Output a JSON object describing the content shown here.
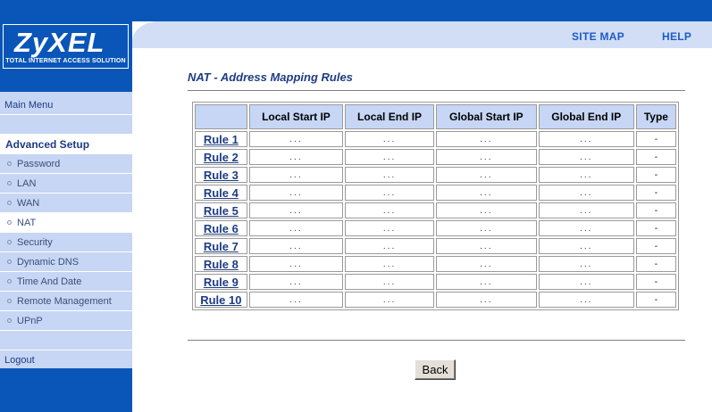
{
  "brand": {
    "name": "ZyXEL",
    "tagline": "Total Internet Access Solution"
  },
  "header": {
    "site_map": "SITE MAP",
    "help": "HELP"
  },
  "sidebar": {
    "main_menu": "Main Menu",
    "section": "Advanced Setup",
    "items": [
      {
        "label": "Password"
      },
      {
        "label": "LAN"
      },
      {
        "label": "WAN"
      },
      {
        "label": "NAT"
      },
      {
        "label": "Security"
      },
      {
        "label": "Dynamic DNS"
      },
      {
        "label": "Time And Date"
      },
      {
        "label": "Remote Management"
      },
      {
        "label": "UPnP"
      }
    ],
    "logout": "Logout"
  },
  "page": {
    "title": "NAT - Address Mapping Rules",
    "back_label": "Back"
  },
  "table": {
    "headers": [
      "",
      "Local Start IP",
      "Local End IP",
      "Global Start IP",
      "Global End IP",
      "Type"
    ],
    "rows": [
      {
        "rule": "Rule 1",
        "local_start": "...",
        "local_end": "...",
        "global_start": "...",
        "global_end": "...",
        "type": "-"
      },
      {
        "rule": "Rule 2",
        "local_start": "...",
        "local_end": "...",
        "global_start": "...",
        "global_end": "...",
        "type": "-"
      },
      {
        "rule": "Rule 3",
        "local_start": "...",
        "local_end": "...",
        "global_start": "...",
        "global_end": "...",
        "type": "-"
      },
      {
        "rule": "Rule 4",
        "local_start": "...",
        "local_end": "...",
        "global_start": "...",
        "global_end": "...",
        "type": "-"
      },
      {
        "rule": "Rule 5",
        "local_start": "...",
        "local_end": "...",
        "global_start": "...",
        "global_end": "...",
        "type": "-"
      },
      {
        "rule": "Rule 6",
        "local_start": "...",
        "local_end": "...",
        "global_start": "...",
        "global_end": "...",
        "type": "-"
      },
      {
        "rule": "Rule 7",
        "local_start": "...",
        "local_end": "...",
        "global_start": "...",
        "global_end": "...",
        "type": "-"
      },
      {
        "rule": "Rule 8",
        "local_start": "...",
        "local_end": "...",
        "global_start": "...",
        "global_end": "...",
        "type": "-"
      },
      {
        "rule": "Rule 9",
        "local_start": "...",
        "local_end": "...",
        "global_start": "...",
        "global_end": "...",
        "type": "-"
      },
      {
        "rule": "Rule 10",
        "local_start": "...",
        "local_end": "...",
        "global_start": "...",
        "global_end": "...",
        "type": "-"
      }
    ]
  },
  "colors": {
    "brand_blue": "#0a56b8",
    "menu_bg": "#c6d6f4",
    "header_light": "#d2def6",
    "text_navy": "#1e3c84",
    "link_blue": "#1e5bc8"
  }
}
